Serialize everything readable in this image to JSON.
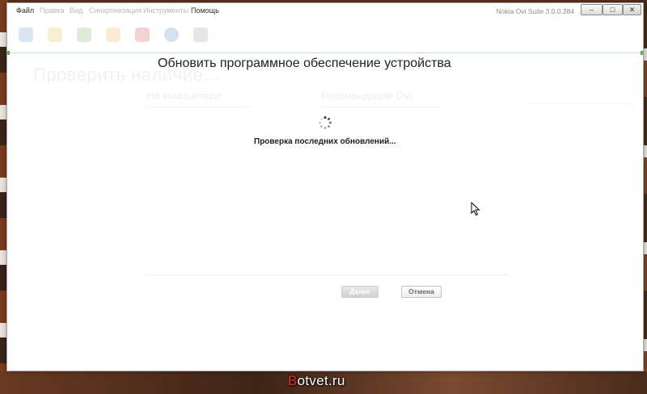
{
  "window": {
    "app_title": "Nokia Ovi Suite 3.0.0.284",
    "controls": {
      "minimize": "–",
      "maximize": "□",
      "close": "✕"
    }
  },
  "menu": {
    "items": [
      {
        "label": "Файл",
        "active": true
      },
      {
        "label": "Правка",
        "active": false
      },
      {
        "label": "Вид",
        "active": false
      },
      {
        "label": "Синхронизация",
        "active": false
      },
      {
        "label": "Инструменты",
        "active": false
      },
      {
        "label": "Помощь",
        "active": true
      }
    ]
  },
  "dialog": {
    "title": "Обновить программное обеспечение устройства",
    "status": "Проверка последних обновлений...",
    "next_label": "Далее",
    "cancel_label": "Отмена"
  },
  "background": {
    "heading": "Проверить наличие...",
    "col1": "На компьютере",
    "col2": "Рекомендации Ovi"
  },
  "toolbar": {
    "icons": [
      "home-icon",
      "folder-icon",
      "photos-icon",
      "message-icon",
      "calendar-icon",
      "globe-icon",
      "notes-icon"
    ]
  },
  "watermark": {
    "first": "B",
    "rest": "otvet.ru"
  },
  "colors": {
    "accent_green": "#4caf50",
    "watermark_red": "#e0312f"
  }
}
